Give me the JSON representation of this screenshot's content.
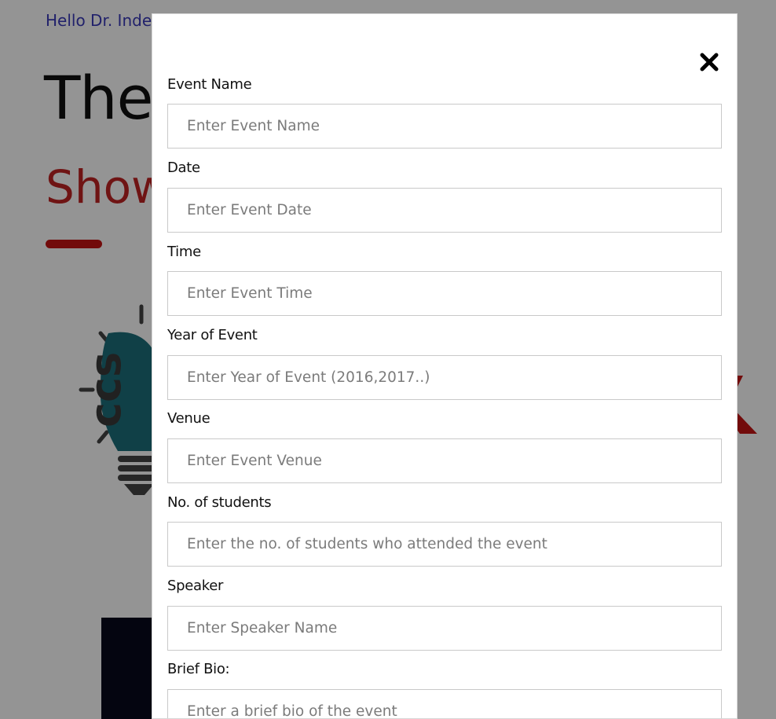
{
  "background": {
    "greeting": "Hello Dr. Inde",
    "title": "The",
    "subtitle": "Show",
    "logo_text": "ccs",
    "accent_color": "#c02424"
  },
  "modal": {
    "close_icon": "close-icon",
    "fields": [
      {
        "label": "Event Name",
        "placeholder": "Enter Event Name",
        "value": ""
      },
      {
        "label": "Date",
        "placeholder": "Enter Event Date",
        "value": ""
      },
      {
        "label": "Time",
        "placeholder": "Enter Event Time",
        "value": ""
      },
      {
        "label": "Year of Event",
        "placeholder": "Enter Year of Event (2016,2017..)",
        "value": ""
      },
      {
        "label": "Venue",
        "placeholder": "Enter Event Venue",
        "value": ""
      },
      {
        "label": "No. of students",
        "placeholder": "Enter the no. of students who attended the event",
        "value": ""
      },
      {
        "label": "Speaker",
        "placeholder": "Enter Speaker Name",
        "value": ""
      },
      {
        "label": "Brief Bio:",
        "placeholder": "Enter a brief bio of the event",
        "value": ""
      }
    ]
  }
}
